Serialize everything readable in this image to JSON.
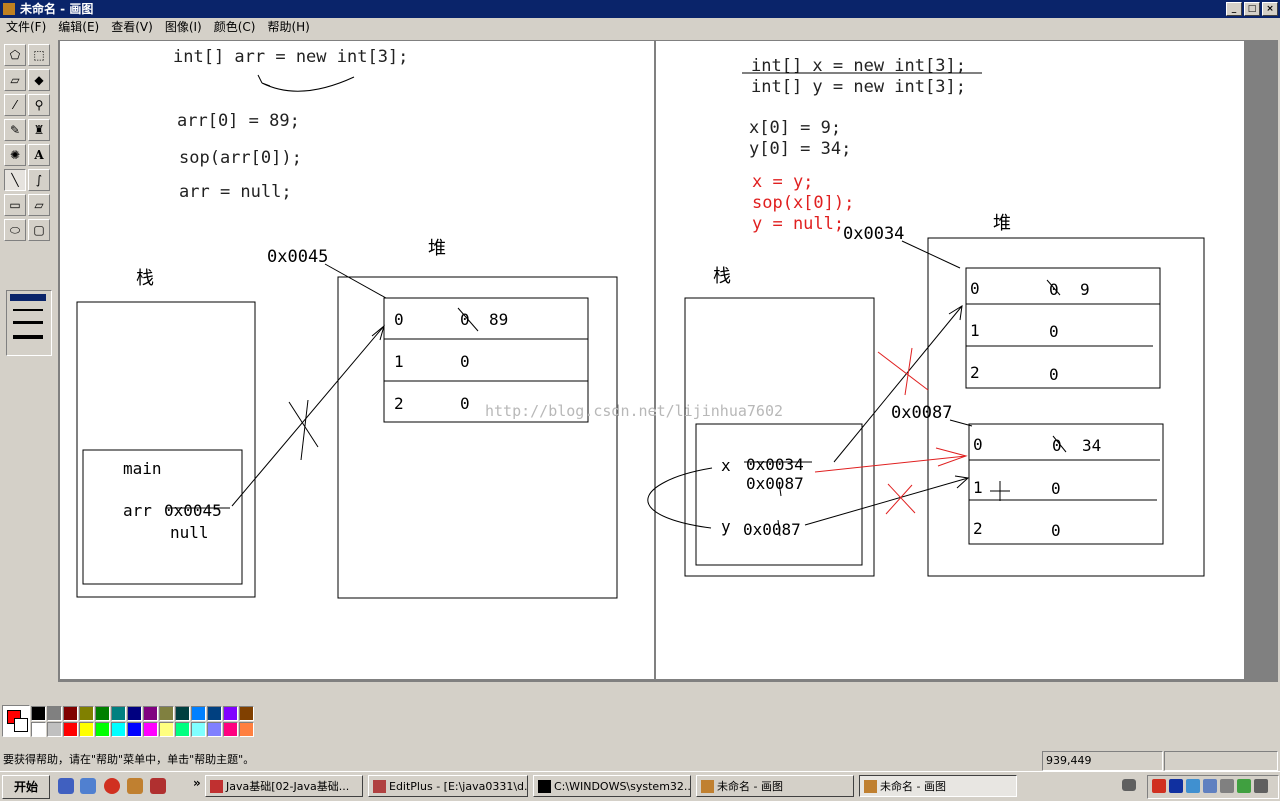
{
  "window": {
    "title": "未命名 - 画图",
    "min_btn": "_",
    "max_btn": "□",
    "close_btn": "×"
  },
  "menu": [
    "文件(F)",
    "编辑(E)",
    "查看(V)",
    "图像(I)",
    "颜色(C)",
    "帮助(H)"
  ],
  "tools": [
    "free-select",
    "rect-select",
    "eraser",
    "fill",
    "color-picker",
    "magnifier",
    "pencil",
    "brush",
    "airbrush",
    "text",
    "line",
    "curve",
    "rectangle",
    "polygon",
    "ellipse",
    "rounded-rectangle"
  ],
  "tool_glyphs": [
    "⬠",
    "⬚",
    "▱",
    "◆",
    "⁄",
    "⚲",
    "✎",
    "♜",
    "✺",
    "A",
    "╲",
    "∫",
    "▭",
    "▱",
    "⬭",
    "▢"
  ],
  "drawing": {
    "left": {
      "code": [
        "int[] arr = new int[3];",
        "arr[0] = 89;",
        "sop(arr[0]);",
        "arr = null;"
      ],
      "stack_label": "栈",
      "heap_label": "堆",
      "address": "0x0045",
      "frame_label": "main",
      "var_name": "arr",
      "var_old": "0x0045",
      "var_new": "null",
      "cells": [
        {
          "index": "0",
          "old": "0",
          "value": "89"
        },
        {
          "index": "1",
          "value": "0"
        },
        {
          "index": "2",
          "value": "0"
        }
      ]
    },
    "right": {
      "code": [
        "int[] x = new int[3];",
        "int[] y = new int[3];",
        "x[0] = 9;",
        "y[0] = 34;"
      ],
      "code_red": [
        "x = y;",
        "sop(x[0]);",
        "y = null;"
      ],
      "stack_label": "栈",
      "heap_label": "堆",
      "address_a": "0x0034",
      "address_b": "0x0087",
      "var_x": "x",
      "var_x_old": "0x0034",
      "var_x_new": "0x0087",
      "var_y": "y",
      "var_y_val": "0x0087",
      "cells_a": [
        {
          "index": "0",
          "old": "0",
          "value": "9"
        },
        {
          "index": "1",
          "value": "0"
        },
        {
          "index": "2",
          "value": "0"
        }
      ],
      "cells_b": [
        {
          "index": "0",
          "old": "0",
          "value": "34"
        },
        {
          "index": "1",
          "value": "0"
        },
        {
          "index": "2",
          "value": "0"
        }
      ]
    },
    "watermark": "http://blog.csdn.net/lijinhua7602",
    "red": "#e02020"
  },
  "palette": {
    "foreground": "#ff0000",
    "background": "#ffffff",
    "colors": [
      "#000000",
      "#808080",
      "#800000",
      "#808000",
      "#008000",
      "#008080",
      "#000080",
      "#800080",
      "#808040",
      "#004040",
      "#0080ff",
      "#004080",
      "#8000ff",
      "#804000",
      "#ffffff",
      "#c0c0c0",
      "#ff0000",
      "#ffff00",
      "#00ff00",
      "#00ffff",
      "#0000ff",
      "#ff00ff",
      "#ffff80",
      "#00ff80",
      "#80ffff",
      "#8080ff",
      "#ff0080",
      "#ff8040"
    ]
  },
  "status": {
    "help": "要获得帮助，请在\"帮助\"菜单中，单击\"帮助主题\"。",
    "coords": "939,449"
  },
  "taskbar": {
    "start": "开始",
    "more": "»",
    "tasks": [
      "Java基础[02-Java基础...",
      "EditPlus - [E:\\java0331\\d...",
      "C:\\WINDOWS\\system32...",
      "未命名 - 画图",
      "未命名 - 画图"
    ]
  }
}
